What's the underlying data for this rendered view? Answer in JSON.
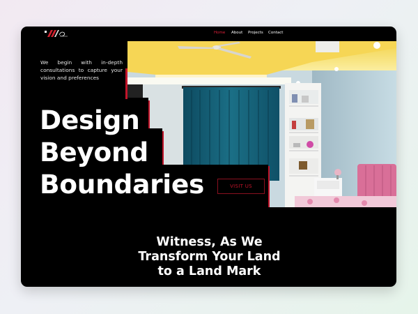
{
  "brand": {
    "logo_icon": "brand-logo-icon"
  },
  "nav": {
    "items": [
      {
        "label": "Home",
        "active": true
      },
      {
        "label": "About",
        "active": false
      },
      {
        "label": "Projects",
        "active": false
      },
      {
        "label": "Contact",
        "active": false
      }
    ]
  },
  "hero": {
    "intro": "We begin with in-depth consultations to capture your vision and preferences",
    "headline_lines": [
      "Design",
      "Beyond",
      "Boundaries"
    ],
    "cta_label": "VISIT US",
    "image_icon": "bedroom-interior-image"
  },
  "tagline_lines": [
    "Witness, As We",
    "Transform Your Land",
    "to a Land Mark"
  ],
  "colors": {
    "accent": "#c2142a",
    "background": "#000000",
    "text": "#ffffff"
  }
}
